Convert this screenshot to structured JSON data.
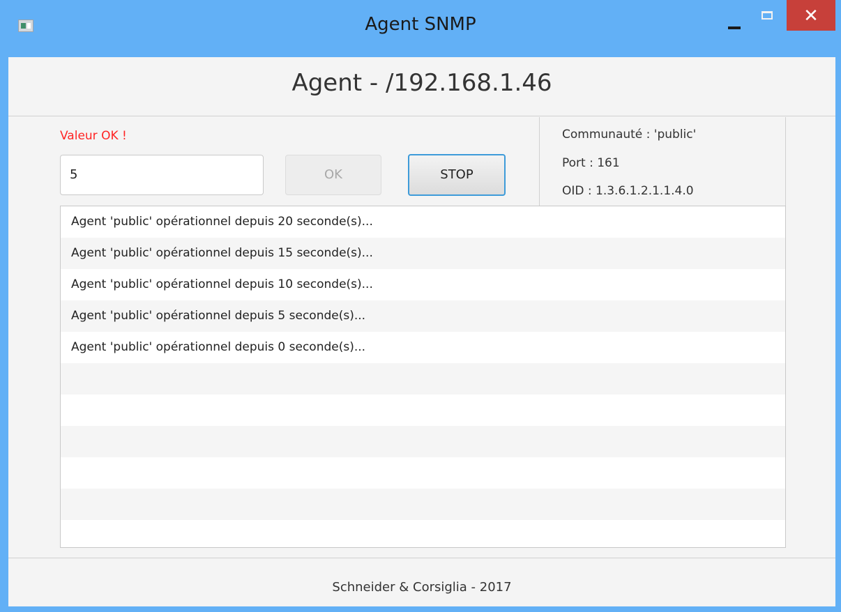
{
  "window": {
    "title": "Agent SNMP",
    "close_glyph": "✕"
  },
  "header": {
    "title": "Agent - /192.168.1.46"
  },
  "controls": {
    "status_message": "Valeur OK !",
    "input_value": "5",
    "ok_label": "OK",
    "stop_label": "STOP"
  },
  "info": {
    "community": "Communauté : 'public'",
    "port": "Port : 161",
    "oid": "OID : 1.3.6.1.2.1.1.4.0"
  },
  "log": {
    "items": [
      "Agent 'public' opérationnel depuis 20 seconde(s)...",
      "Agent 'public' opérationnel depuis 15 seconde(s)...",
      "Agent 'public' opérationnel depuis 10 seconde(s)...",
      "Agent 'public' opérationnel depuis 5 seconde(s)...",
      "Agent 'public' opérationnel depuis 0 seconde(s)...",
      "",
      "",
      "",
      "",
      "",
      ""
    ]
  },
  "footer": {
    "text": "Schneider & Corsiglia - 2017"
  },
  "colors": {
    "title_bar": "#62b0f6",
    "close_button": "#c7403a",
    "status_message": "#ff2424",
    "focus_border": "#3d9bd9"
  },
  "icons": [
    "app-icon",
    "minimize-icon",
    "maximize-icon",
    "close-icon"
  ]
}
